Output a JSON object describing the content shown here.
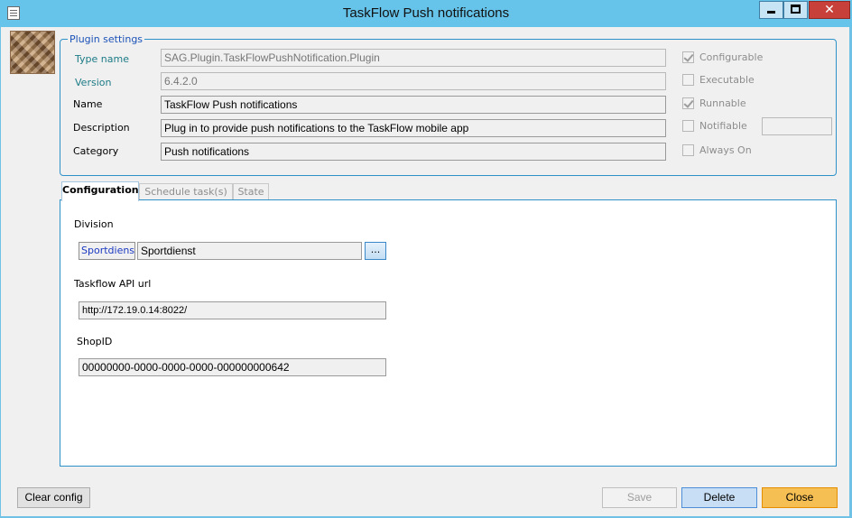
{
  "window": {
    "title": "TaskFlow Push notifications",
    "minimize_icon": "minimize-icon",
    "maximize_icon": "maximize-icon",
    "close_glyph": "✕"
  },
  "plugin_settings": {
    "legend": "Plugin settings",
    "type_name": {
      "label": "Type name",
      "value": "SAG.Plugin.TaskFlowPushNotification.Plugin"
    },
    "version": {
      "label": "Version",
      "value": "6.4.2.0"
    },
    "name": {
      "label": "Name",
      "value": "TaskFlow Push notifications"
    },
    "description": {
      "label": "Description",
      "value": "Plug in to provide push notifications to the TaskFlow mobile app"
    },
    "category": {
      "label": "Category",
      "value": "Push notifications"
    },
    "options": [
      {
        "label": "Configurable",
        "checked": true
      },
      {
        "label": "Executable",
        "checked": false
      },
      {
        "label": "Runnable",
        "checked": true
      },
      {
        "label": "Notifiable",
        "checked": false
      },
      {
        "label": "Always On",
        "checked": false
      }
    ],
    "notifiable_value": ""
  },
  "tabs": [
    {
      "label": "Configuration",
      "active": true
    },
    {
      "label": "Schedule task(s)",
      "active": false
    },
    {
      "label": "State",
      "active": false
    }
  ],
  "configuration": {
    "division": {
      "label": "Division",
      "code": "Sportdiens",
      "name": "Sportdienst",
      "browse_label": "..."
    },
    "api_url": {
      "label": "Taskflow API url",
      "value": "http://172.19.0.14:8022/"
    },
    "shop_id": {
      "label": "ShopID",
      "value": "00000000-0000-0000-0000-000000000642"
    }
  },
  "footer": {
    "clear_config": "Clear config",
    "save": "Save",
    "delete": "Delete",
    "close": "Close"
  },
  "colors": {
    "title_bar": "#66c3ea",
    "frame_blue": "#2e92c9",
    "close_button": "#f5bf54",
    "delete_button": "#c8def4"
  }
}
